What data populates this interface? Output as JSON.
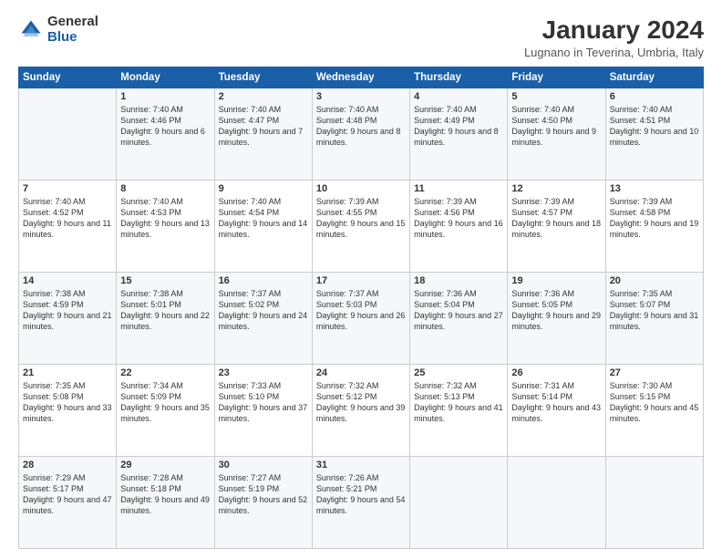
{
  "logo": {
    "general": "General",
    "blue": "Blue"
  },
  "header": {
    "title": "January 2024",
    "subtitle": "Lugnano in Teverina, Umbria, Italy"
  },
  "columns": [
    "Sunday",
    "Monday",
    "Tuesday",
    "Wednesday",
    "Thursday",
    "Friday",
    "Saturday"
  ],
  "weeks": [
    [
      {
        "day": "",
        "sunrise": "",
        "sunset": "",
        "daylight": ""
      },
      {
        "day": "1",
        "sunrise": "Sunrise: 7:40 AM",
        "sunset": "Sunset: 4:46 PM",
        "daylight": "Daylight: 9 hours and 6 minutes."
      },
      {
        "day": "2",
        "sunrise": "Sunrise: 7:40 AM",
        "sunset": "Sunset: 4:47 PM",
        "daylight": "Daylight: 9 hours and 7 minutes."
      },
      {
        "day": "3",
        "sunrise": "Sunrise: 7:40 AM",
        "sunset": "Sunset: 4:48 PM",
        "daylight": "Daylight: 9 hours and 8 minutes."
      },
      {
        "day": "4",
        "sunrise": "Sunrise: 7:40 AM",
        "sunset": "Sunset: 4:49 PM",
        "daylight": "Daylight: 9 hours and 8 minutes."
      },
      {
        "day": "5",
        "sunrise": "Sunrise: 7:40 AM",
        "sunset": "Sunset: 4:50 PM",
        "daylight": "Daylight: 9 hours and 9 minutes."
      },
      {
        "day": "6",
        "sunrise": "Sunrise: 7:40 AM",
        "sunset": "Sunset: 4:51 PM",
        "daylight": "Daylight: 9 hours and 10 minutes."
      }
    ],
    [
      {
        "day": "7",
        "sunrise": "Sunrise: 7:40 AM",
        "sunset": "Sunset: 4:52 PM",
        "daylight": "Daylight: 9 hours and 11 minutes."
      },
      {
        "day": "8",
        "sunrise": "Sunrise: 7:40 AM",
        "sunset": "Sunset: 4:53 PM",
        "daylight": "Daylight: 9 hours and 13 minutes."
      },
      {
        "day": "9",
        "sunrise": "Sunrise: 7:40 AM",
        "sunset": "Sunset: 4:54 PM",
        "daylight": "Daylight: 9 hours and 14 minutes."
      },
      {
        "day": "10",
        "sunrise": "Sunrise: 7:39 AM",
        "sunset": "Sunset: 4:55 PM",
        "daylight": "Daylight: 9 hours and 15 minutes."
      },
      {
        "day": "11",
        "sunrise": "Sunrise: 7:39 AM",
        "sunset": "Sunset: 4:56 PM",
        "daylight": "Daylight: 9 hours and 16 minutes."
      },
      {
        "day": "12",
        "sunrise": "Sunrise: 7:39 AM",
        "sunset": "Sunset: 4:57 PM",
        "daylight": "Daylight: 9 hours and 18 minutes."
      },
      {
        "day": "13",
        "sunrise": "Sunrise: 7:39 AM",
        "sunset": "Sunset: 4:58 PM",
        "daylight": "Daylight: 9 hours and 19 minutes."
      }
    ],
    [
      {
        "day": "14",
        "sunrise": "Sunrise: 7:38 AM",
        "sunset": "Sunset: 4:59 PM",
        "daylight": "Daylight: 9 hours and 21 minutes."
      },
      {
        "day": "15",
        "sunrise": "Sunrise: 7:38 AM",
        "sunset": "Sunset: 5:01 PM",
        "daylight": "Daylight: 9 hours and 22 minutes."
      },
      {
        "day": "16",
        "sunrise": "Sunrise: 7:37 AM",
        "sunset": "Sunset: 5:02 PM",
        "daylight": "Daylight: 9 hours and 24 minutes."
      },
      {
        "day": "17",
        "sunrise": "Sunrise: 7:37 AM",
        "sunset": "Sunset: 5:03 PM",
        "daylight": "Daylight: 9 hours and 26 minutes."
      },
      {
        "day": "18",
        "sunrise": "Sunrise: 7:36 AM",
        "sunset": "Sunset: 5:04 PM",
        "daylight": "Daylight: 9 hours and 27 minutes."
      },
      {
        "day": "19",
        "sunrise": "Sunrise: 7:36 AM",
        "sunset": "Sunset: 5:05 PM",
        "daylight": "Daylight: 9 hours and 29 minutes."
      },
      {
        "day": "20",
        "sunrise": "Sunrise: 7:35 AM",
        "sunset": "Sunset: 5:07 PM",
        "daylight": "Daylight: 9 hours and 31 minutes."
      }
    ],
    [
      {
        "day": "21",
        "sunrise": "Sunrise: 7:35 AM",
        "sunset": "Sunset: 5:08 PM",
        "daylight": "Daylight: 9 hours and 33 minutes."
      },
      {
        "day": "22",
        "sunrise": "Sunrise: 7:34 AM",
        "sunset": "Sunset: 5:09 PM",
        "daylight": "Daylight: 9 hours and 35 minutes."
      },
      {
        "day": "23",
        "sunrise": "Sunrise: 7:33 AM",
        "sunset": "Sunset: 5:10 PM",
        "daylight": "Daylight: 9 hours and 37 minutes."
      },
      {
        "day": "24",
        "sunrise": "Sunrise: 7:32 AM",
        "sunset": "Sunset: 5:12 PM",
        "daylight": "Daylight: 9 hours and 39 minutes."
      },
      {
        "day": "25",
        "sunrise": "Sunrise: 7:32 AM",
        "sunset": "Sunset: 5:13 PM",
        "daylight": "Daylight: 9 hours and 41 minutes."
      },
      {
        "day": "26",
        "sunrise": "Sunrise: 7:31 AM",
        "sunset": "Sunset: 5:14 PM",
        "daylight": "Daylight: 9 hours and 43 minutes."
      },
      {
        "day": "27",
        "sunrise": "Sunrise: 7:30 AM",
        "sunset": "Sunset: 5:15 PM",
        "daylight": "Daylight: 9 hours and 45 minutes."
      }
    ],
    [
      {
        "day": "28",
        "sunrise": "Sunrise: 7:29 AM",
        "sunset": "Sunset: 5:17 PM",
        "daylight": "Daylight: 9 hours and 47 minutes."
      },
      {
        "day": "29",
        "sunrise": "Sunrise: 7:28 AM",
        "sunset": "Sunset: 5:18 PM",
        "daylight": "Daylight: 9 hours and 49 minutes."
      },
      {
        "day": "30",
        "sunrise": "Sunrise: 7:27 AM",
        "sunset": "Sunset: 5:19 PM",
        "daylight": "Daylight: 9 hours and 52 minutes."
      },
      {
        "day": "31",
        "sunrise": "Sunrise: 7:26 AM",
        "sunset": "Sunset: 5:21 PM",
        "daylight": "Daylight: 9 hours and 54 minutes."
      },
      {
        "day": "",
        "sunrise": "",
        "sunset": "",
        "daylight": ""
      },
      {
        "day": "",
        "sunrise": "",
        "sunset": "",
        "daylight": ""
      },
      {
        "day": "",
        "sunrise": "",
        "sunset": "",
        "daylight": ""
      }
    ]
  ]
}
